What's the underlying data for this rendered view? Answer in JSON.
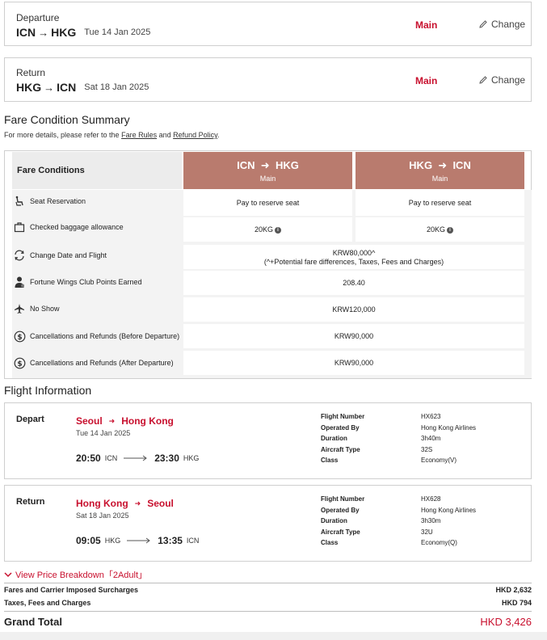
{
  "segments": [
    {
      "label": "Departure",
      "from": "ICN",
      "to": "HKG",
      "date": "Tue 14 Jan 2025",
      "cabin": "Main",
      "change_label": "Change"
    },
    {
      "label": "Return",
      "from": "HKG",
      "to": "ICN",
      "date": "Sat 18 Jan 2025",
      "cabin": "Main",
      "change_label": "Change"
    }
  ],
  "fare_summary": {
    "title": "Fare Condition Summary",
    "note_prefix": "For more details, please refer to the ",
    "fare_rules_link": "Fare Rules",
    "note_and": " and ",
    "refund_policy_link": "Refund Policy",
    "note_suffix": ".",
    "header_label": "Fare Conditions",
    "routes": [
      {
        "from": "ICN",
        "to": "HKG",
        "cabin": "Main"
      },
      {
        "from": "HKG",
        "to": "ICN",
        "cabin": "Main"
      }
    ],
    "rows": {
      "seat": {
        "label": "Seat Reservation",
        "icon": "seat-icon",
        "out": "Pay to reserve seat",
        "ret": "Pay to reserve seat"
      },
      "baggage": {
        "label": "Checked baggage allowance",
        "icon": "baggage-icon",
        "out": "20KG",
        "ret": "20KG"
      },
      "change": {
        "label": "Change Date and Flight",
        "icon": "refresh-icon",
        "value": "KRW80,000^",
        "value_note": "(^+Potential fare differences, Taxes, Fees and Charges)"
      },
      "points": {
        "label": "Fortune Wings Club Points Earned",
        "icon": "member-icon",
        "value": "208.40"
      },
      "noshow": {
        "label": "No Show",
        "icon": "plane-icon",
        "value": "KRW120,000"
      },
      "cancel_before": {
        "label": "Cancellations and Refunds (Before Departure)",
        "icon": "dollar-icon",
        "value": "KRW90,000"
      },
      "cancel_after": {
        "label": "Cancellations and Refunds (After Departure)",
        "icon": "dollar-icon",
        "value": "KRW90,000"
      }
    }
  },
  "flight_info": {
    "title": "Flight Information",
    "flights": [
      {
        "kind": "Depart",
        "from_city": "Seoul",
        "to_city": "Hong Kong",
        "date": "Tue 14 Jan 2025",
        "dep_time": "20:50",
        "dep_code": "ICN",
        "arr_time": "23:30",
        "arr_code": "HKG",
        "details": {
          "flight_number_label": "Flight Number",
          "flight_number": "HX623",
          "operated_label": "Operated By",
          "operated": "Hong Kong Airlines",
          "duration_label": "Duration",
          "duration": "3h40m",
          "aircraft_label": "Aircraft Type",
          "aircraft": "32S",
          "class_label": "Class",
          "class": "Economy(V)"
        }
      },
      {
        "kind": "Return",
        "from_city": "Hong Kong",
        "to_city": "Seoul",
        "date": "Sat 18 Jan 2025",
        "dep_time": "09:05",
        "dep_code": "HKG",
        "arr_time": "13:35",
        "arr_code": "ICN",
        "details": {
          "flight_number_label": "Flight Number",
          "flight_number": "HX628",
          "operated_label": "Operated By",
          "operated": "Hong Kong Airlines",
          "duration_label": "Duration",
          "duration": "3h30m",
          "aircraft_label": "Aircraft Type",
          "aircraft": "32U",
          "class_label": "Class",
          "class": "Economy(Q)"
        }
      }
    ]
  },
  "price": {
    "breakdown_label": "View Price Breakdown「2Adult」",
    "fares_label": "Fares and Carrier Imposed Surcharges",
    "fares_value": "HKD 2,632",
    "taxes_label": "Taxes, Fees and Charges",
    "taxes_value": "HKD 794",
    "grand_label": "Grand Total",
    "grand_value": "HKD 3,426"
  },
  "colors": {
    "accent": "#c8102e",
    "route_header": "#b97b6e"
  }
}
